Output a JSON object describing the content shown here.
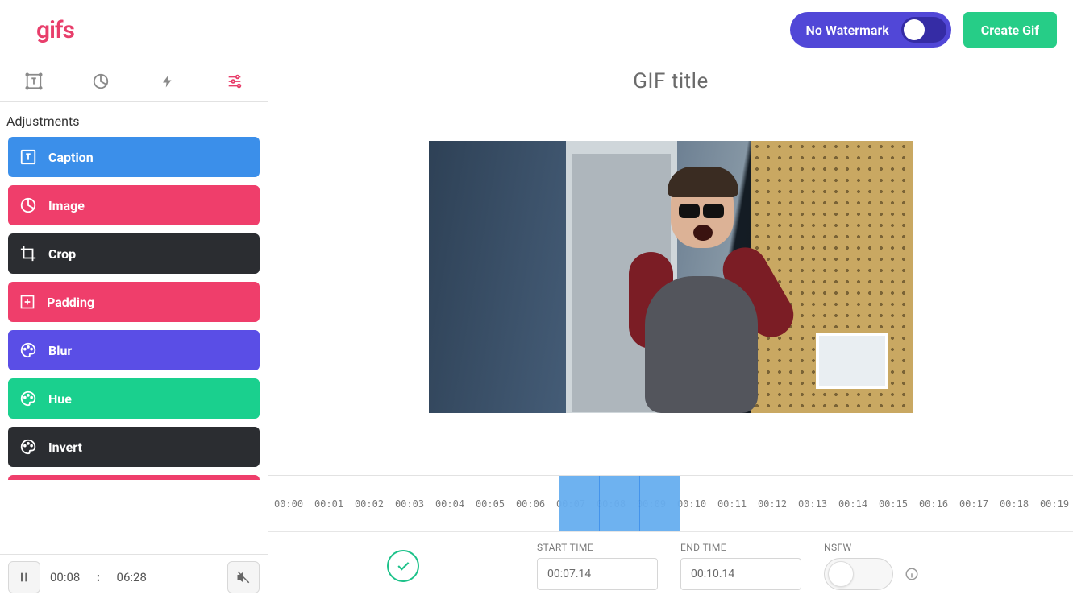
{
  "header": {
    "logo": "gifs",
    "watermark_label": "No Watermark",
    "create_label": "Create Gif"
  },
  "sidebar": {
    "panel_title": "Adjustments",
    "items": [
      {
        "label": "Caption",
        "icon": "caption-icon",
        "color": "blue"
      },
      {
        "label": "Image",
        "icon": "image-icon",
        "color": "pink"
      },
      {
        "label": "Crop",
        "icon": "crop-icon",
        "color": "dark"
      },
      {
        "label": "Padding",
        "icon": "padding-icon",
        "color": "pink"
      },
      {
        "label": "Blur",
        "icon": "palette-icon",
        "color": "purple"
      },
      {
        "label": "Hue",
        "icon": "palette-icon",
        "color": "green"
      },
      {
        "label": "Invert",
        "icon": "palette-icon",
        "color": "dark"
      }
    ]
  },
  "player": {
    "current_time": "00:08",
    "total_time": "06:28"
  },
  "preview": {
    "title_placeholder": "GIF title"
  },
  "timeline": {
    "ticks": [
      "00:00",
      "00:01",
      "00:02",
      "00:03",
      "00:04",
      "00:05",
      "00:06",
      "00:07",
      "00:08",
      "00:09",
      "00:10",
      "00:11",
      "00:12",
      "00:13",
      "00:14",
      "00:15",
      "00:16",
      "00:17",
      "00:18",
      "00:19"
    ],
    "selection_start_index": 7,
    "selection_end_index": 10,
    "divider_indices": [
      8,
      9
    ]
  },
  "bottom": {
    "start_label": "START TIME",
    "start_value": "00:07.14",
    "end_label": "END TIME",
    "end_value": "00:10.14",
    "nsfw_label": "NSFW",
    "nsfw_state": "OFF"
  }
}
